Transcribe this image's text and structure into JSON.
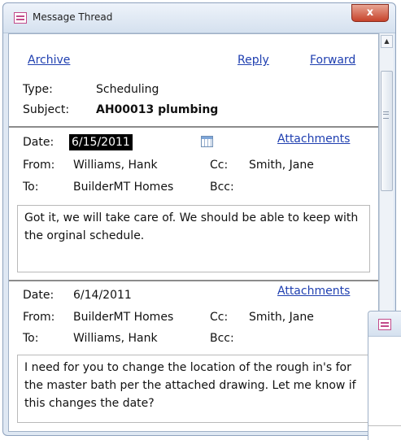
{
  "window": {
    "title": "Message Thread",
    "close_glyph": "x"
  },
  "toolbar": {
    "archive": "Archive",
    "reply": "Reply",
    "forward": "Forward"
  },
  "thread": {
    "type_label": "Type:",
    "type_value": "Scheduling",
    "subject_label": "Subject:",
    "subject_value": "AH00013 plumbing"
  },
  "messages": [
    {
      "date_label": "Date:",
      "date": "6/15/2011",
      "attachments": "Attachments",
      "from_label": "From:",
      "from": "Williams, Hank",
      "cc_label": "Cc:",
      "cc": "Smith, Jane",
      "to_label": "To:",
      "to": "BuilderMT Homes",
      "bcc_label": "Bcc:",
      "bcc": "",
      "body": "Got it, we will take care of.  We should be able to keep with the orginal schedule."
    },
    {
      "date_label": "Date:",
      "date": "6/14/2011",
      "attachments": "Attachments",
      "from_label": "From:",
      "from": "BuilderMT Homes",
      "cc_label": "Cc:",
      "cc": "Smith, Jane",
      "to_label": "To:",
      "to": "Williams, Hank",
      "bcc_label": "Bcc:",
      "bcc": "",
      "body": "I need for you to change the location of the rough in's for the master bath per the attached drawing.  Let me know if this changes the date?"
    }
  ],
  "icons": {
    "app": "form-icon",
    "calendar": "calendar-icon",
    "scroll_up": "scroll-up-arrow"
  },
  "colors": {
    "link": "#1f3fb0",
    "close_button": "#c7432b",
    "selection": "#000000"
  }
}
